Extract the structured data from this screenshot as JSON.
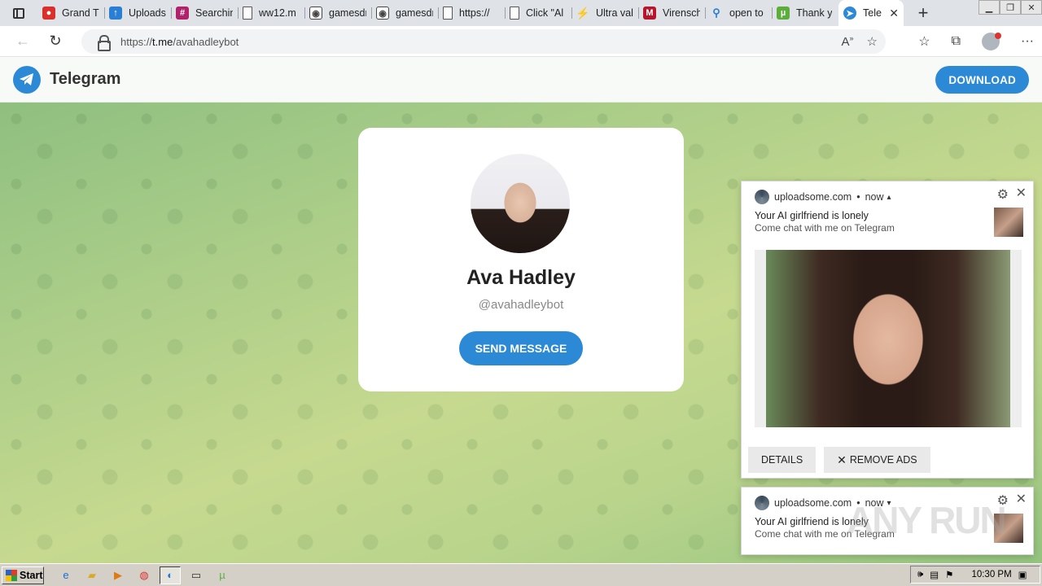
{
  "browser": {
    "tabs": [
      {
        "title": "Grand Th",
        "icon": "red-icon",
        "color": "#d9302c"
      },
      {
        "title": "Uploadsome",
        "icon": "upload-icon",
        "color": "#2a7fd4"
      },
      {
        "title": "Searching",
        "icon": "slack-icon",
        "color": "#b0226a"
      },
      {
        "title": "ww12.m",
        "icon": "page-icon",
        "color": "#666666"
      },
      {
        "title": "gamesdr",
        "icon": "gamepad-icon",
        "color": "#444444"
      },
      {
        "title": "gamesdr",
        "icon": "gamepad-icon",
        "color": "#444444"
      },
      {
        "title": "https://",
        "icon": "page-icon",
        "color": "#666666"
      },
      {
        "title": "Click \"Al",
        "icon": "page-icon",
        "color": "#666666"
      },
      {
        "title": "Ultra val",
        "icon": "bolt-icon",
        "color": "#e8a21c"
      },
      {
        "title": "Virensch",
        "icon": "shield-icon",
        "color": "#b5162c"
      },
      {
        "title": "open to",
        "icon": "search-icon",
        "color": "#2a7fd4"
      },
      {
        "title": "Thank y",
        "icon": "utorrent-icon",
        "color": "#5cae3b"
      },
      {
        "title": "Tele",
        "icon": "telegram-icon",
        "color": "#2c89d6",
        "active": true
      }
    ],
    "url_prefix": "https://",
    "url_host": "t.me",
    "url_path": "/avahadleybot"
  },
  "telegram": {
    "brand": "Telegram",
    "download_label": "DOWNLOAD",
    "profile": {
      "name": "Ava Hadley",
      "handle": "@avahadleybot",
      "send_label": "SEND MESSAGE"
    }
  },
  "notifications": [
    {
      "source": "uploadsome.com",
      "time": "now",
      "chevron": "▴",
      "title": "Your AI girlfriend is lonely",
      "body": "Come chat with me on Telegram",
      "details_label": "DETAILS",
      "remove_label": "REMOVE ADS"
    },
    {
      "source": "uploadsome.com",
      "time": "now",
      "chevron": "▾",
      "title": "Your AI girlfriend is lonely",
      "body": "Come chat with me on Telegram"
    }
  ],
  "watermark": "ANY RUN",
  "taskbar": {
    "start_label": "Start",
    "clock": "10:30 PM"
  }
}
